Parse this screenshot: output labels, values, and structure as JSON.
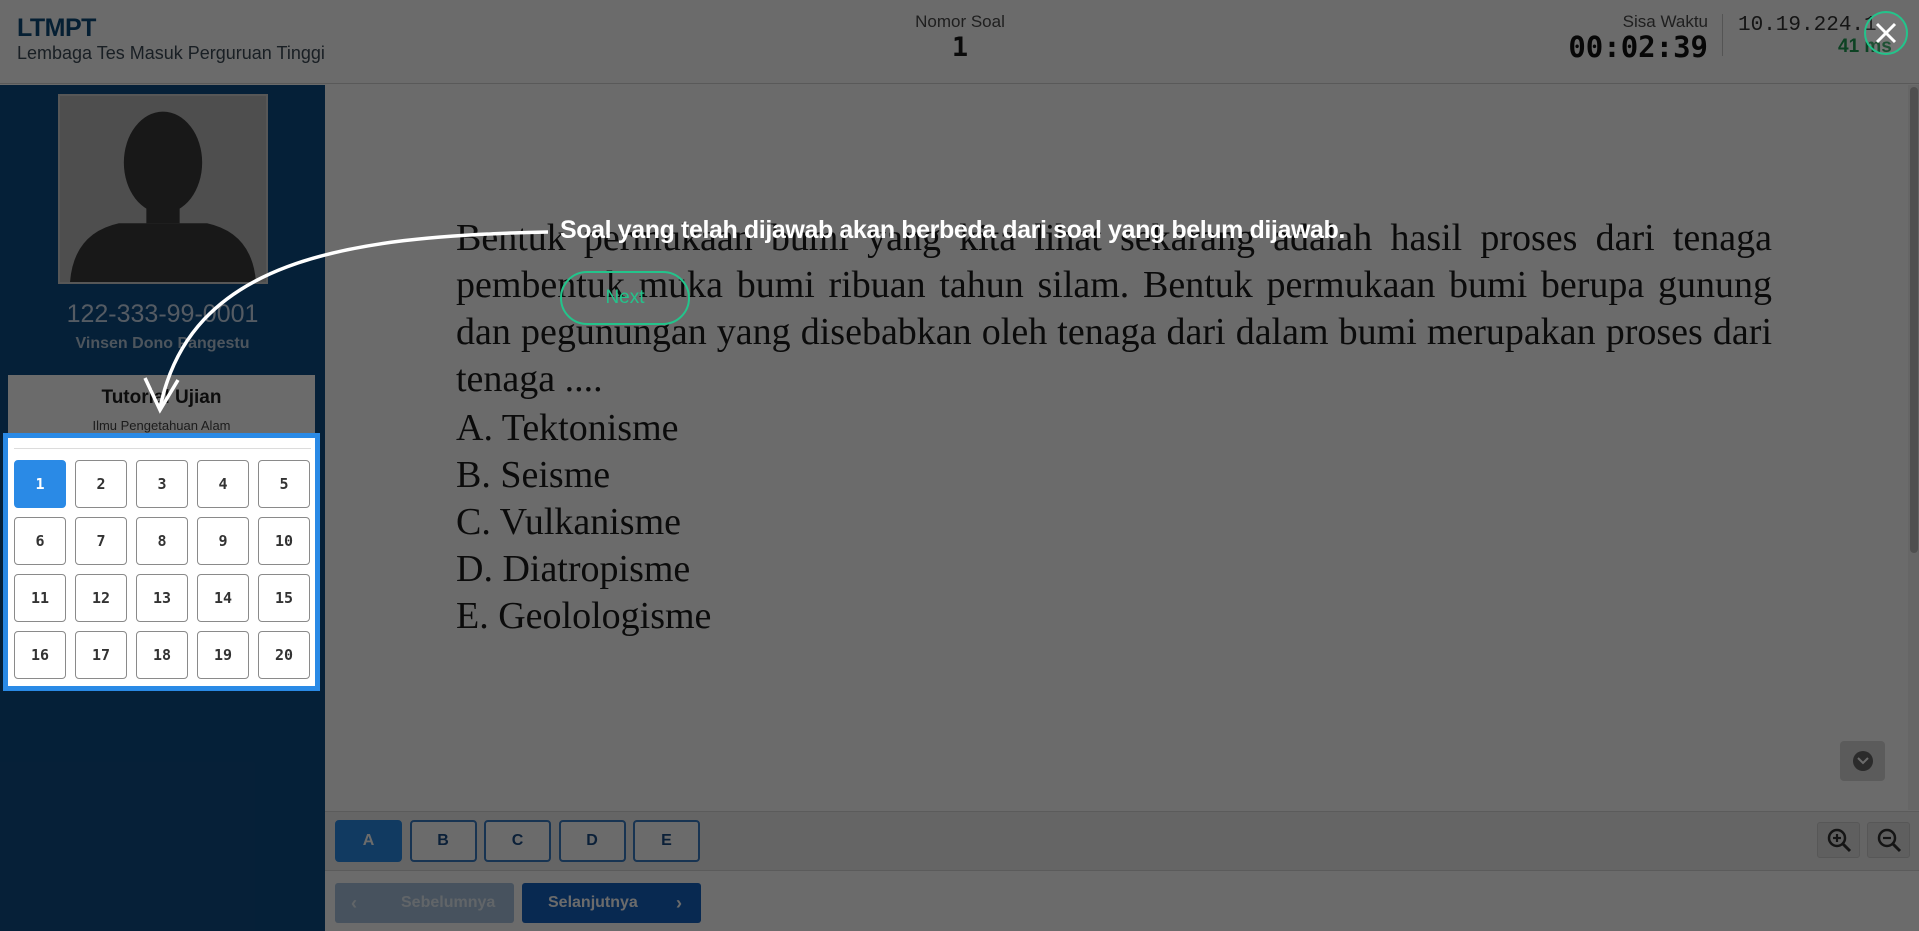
{
  "header": {
    "brand_title": "LTMPT",
    "brand_subtitle": "Lembaga Tes Masuk Perguruan Tinggi",
    "question_label": "Nomor Soal",
    "question_number": "1",
    "timer_label": "Sisa Waktu",
    "timer_value": "00:02:39",
    "ip_address": "10.19.224.1",
    "ping": "41 ms"
  },
  "sidebar": {
    "user_id": "122-333-99-0001",
    "user_name": "Vinsen Dono Pangestu",
    "exam_title": "Tutorial Ujian",
    "exam_subtitle": "Ilmu Pengetahuan Alam",
    "question_buttons": [
      "1",
      "2",
      "3",
      "4",
      "5",
      "6",
      "7",
      "8",
      "9",
      "10",
      "11",
      "12",
      "13",
      "14",
      "15",
      "16",
      "17",
      "18",
      "19",
      "20"
    ],
    "active_question": "1"
  },
  "question": {
    "text": "Bentuk permukaan bumi yang kita lihat sekarang adalah hasil proses dari tenaga pembentuk muka bumi ribuan tahun silam. Bentuk permukaan bumi berupa gunung dan pegunungan yang disebabkan oleh tenaga dari dalam bumi merupakan proses dari tenaga ....",
    "choices": [
      "A. Tektonisme",
      "B. Seisme",
      "C. Vulkanisme",
      "D. Diatropisme",
      "E. Geolologisme"
    ]
  },
  "answers": {
    "options": [
      "A",
      "B",
      "C",
      "D",
      "E"
    ],
    "selected": "A"
  },
  "navigation": {
    "prev_label": "Sebelumnya",
    "next_label": "Selanjutnya"
  },
  "tutorial": {
    "tip_text": "Soal yang telah dijawab akan berbeda dari soal yang belum dijawab.",
    "next_label": "Next"
  },
  "colors": {
    "primary": "#0e4d85",
    "accent": "#2a8ae6",
    "tutorial_accent": "#23c48b"
  }
}
